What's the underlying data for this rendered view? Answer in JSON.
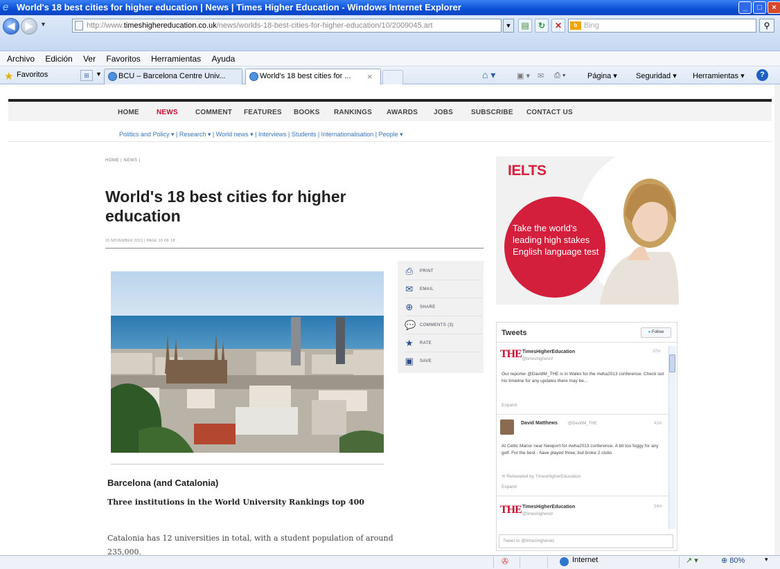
{
  "window": {
    "title": "World's 18 best cities for higher education | News | Times Higher Education - Windows Internet Explorer"
  },
  "address": {
    "prefix": "http://www.",
    "host": "timeshighereducation.co.uk",
    "path": "/news/worlds-18-best-cities-for-higher-education/10/2009045.art"
  },
  "search": {
    "placeholder": "Bing"
  },
  "menu": [
    "Archivo",
    "Edición",
    "Ver",
    "Favoritos",
    "Herramientas",
    "Ayuda"
  ],
  "favorites": {
    "label": "Favoritos",
    "tabs": [
      "BCU – Barcelona Centre Univ...",
      "World's 18 best cities for ..."
    ],
    "tab_close": "×"
  },
  "commands": {
    "pagina": "Página ▾",
    "seguridad": "Seguridad ▾",
    "herramientas": "Herramientas ▾"
  },
  "site_nav": [
    "HOME",
    "NEWS",
    "COMMENT",
    "FEATURES",
    "BOOKS",
    "RANKINGS",
    "AWARDS",
    "JOBS",
    "SUBSCRIBE",
    "CONTACT US"
  ],
  "sub_nav": "Politics and Policy ▾  |  Research ▾  |  World news ▾  |  Interviews  |  Students  |  Internationalisation  |  People ▾",
  "article": {
    "breadcrumb": "HOME  |  NEWS  |",
    "title": "World's 18 best cities for higher education",
    "date": "15 NOVEMBER 2013  |  PAGE 10 OF 18",
    "section_heading": "Barcelona (and Catalonia)",
    "section_subheading": "Three institutions in the World University Rankings top 400",
    "body": "Catalonia has 12 universities in total, with a student population of around 235,000."
  },
  "share": {
    "print": "PRINT",
    "email": "EMAIL",
    "share": "SHARE",
    "comments": "COMMENTS (3)",
    "rate": "RATE",
    "save": "SAVE"
  },
  "ad": {
    "brand": "IELTS",
    "text": "Take the world's leading high stakes English language test"
  },
  "tweets": {
    "title": "Tweets",
    "follow": "Follow",
    "input_placeholder": "Tweet to @timeshighered",
    "items": [
      {
        "name": "TimesHigherEducation",
        "handle": "@timeshighered",
        "time": "37m",
        "text": "Our reporter @DavidM_THE is in Wales for the #wha2013 conference. Check out his timeline for any updates there may be...",
        "expand": "Expand"
      },
      {
        "name": "David Matthews",
        "handle": "@DavidM_THE",
        "time": "41m",
        "text": "At Celtic Manor near Newport for #wha2013 conference. A bit too foggy for any golf. For the best - have played three, but broke 2 clubs",
        "retweet": "Retweeted by TimesHigherEducation",
        "expand": "Expand"
      },
      {
        "name": "TimesHigherEducation",
        "handle": "@timeshighered",
        "time": "54m"
      }
    ]
  },
  "status": {
    "zone": "Internet",
    "zoom": "80%"
  }
}
